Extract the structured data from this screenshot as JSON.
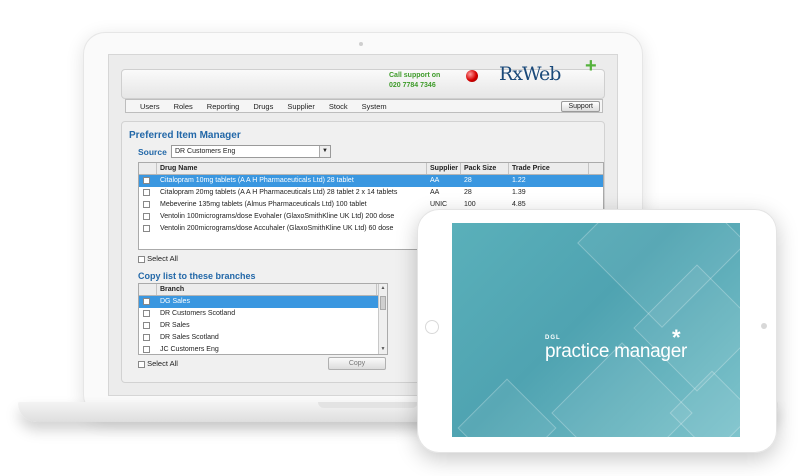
{
  "header": {
    "call_line1": "Call support on",
    "call_line2": "020 7784 7346",
    "logo_text": "RxWeb",
    "logo_plus": "+"
  },
  "menu": {
    "items": [
      "Users",
      "Roles",
      "Reporting",
      "Drugs",
      "Supplier",
      "Stock",
      "System"
    ],
    "support_label": "Support"
  },
  "preferred": {
    "title": "Preferred Item Manager",
    "source_label": "Source",
    "source_value": "DR Customers Eng",
    "columns": [
      "Drug Name",
      "Supplier",
      "Pack Size",
      "Trade Price"
    ],
    "rows": [
      {
        "name": "Citalopram 10mg tablets (A A H Pharmaceuticals Ltd) 28 tablet",
        "supplier": "AA",
        "pack": "28",
        "price": "1.22",
        "selected": true
      },
      {
        "name": "Citalopram 20mg tablets (A A H Pharmaceuticals Ltd) 28 tablet 2 x 14 tablets",
        "supplier": "AA",
        "pack": "28",
        "price": "1.39",
        "selected": false
      },
      {
        "name": "Mebeverine 135mg tablets (Almus Pharmaceuticals Ltd) 100 tablet",
        "supplier": "UNIC",
        "pack": "100",
        "price": "4.85",
        "selected": false
      },
      {
        "name": "Ventolin 100micrograms/dose Evohaler (GlaxoSmithKline UK Ltd) 200 dose",
        "supplier": "",
        "pack": "",
        "price": "",
        "selected": false
      },
      {
        "name": "Ventolin 200micrograms/dose Accuhaler (GlaxoSmithKline UK Ltd) 60 dose",
        "supplier": "",
        "pack": "",
        "price": "",
        "selected": false
      }
    ],
    "select_all_label": "Select All"
  },
  "copy": {
    "title": "Copy list to these branches",
    "column": "Branch",
    "branches": [
      "DG Sales",
      "DR Customers Scotland",
      "DR Sales",
      "DR Sales Scotland",
      "JC Customers Eng"
    ],
    "select_all_label": "Select All",
    "copy_button": "Copy"
  },
  "tablet": {
    "brand_small": "DGL",
    "brand_big": "practice manager",
    "brand_star": "*",
    "bg_color": "#56aab6"
  }
}
